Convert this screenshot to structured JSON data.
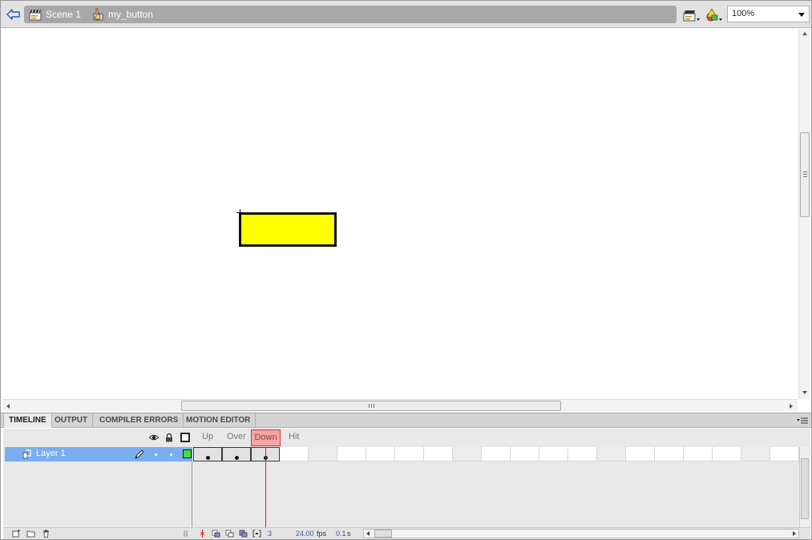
{
  "editbar": {
    "scene_label": "Scene 1",
    "symbol_label": "my_button",
    "zoom_value": "100%",
    "icons": {
      "back": "back-arrow-icon",
      "scene": "clapperboard-icon",
      "symbol": "button-symbol-icon",
      "edit_scene": "edit-scene-icon",
      "edit_symbol": "edit-symbol-icon"
    }
  },
  "stage": {
    "background_color": "#ffffff",
    "shape_fill": "#ffff00",
    "shape_stroke": "#111111"
  },
  "panel_tabs": [
    {
      "label": "TIMELINE",
      "active": true
    },
    {
      "label": "OUTPUT",
      "active": false
    },
    {
      "label": "COMPILER ERRORS",
      "active": false
    },
    {
      "label": "MOTION EDITOR",
      "active": false
    }
  ],
  "timeline": {
    "frame_labels": {
      "up": "Up",
      "over": "Over",
      "down": "Down",
      "hit": "Hit"
    },
    "layers": [
      {
        "name": "Layer 1",
        "selected": true,
        "outline_color": "#44dd44"
      }
    ],
    "keyframes": [
      1,
      2,
      3
    ],
    "current_frame": 3,
    "footer": {
      "current_frame": "3",
      "fps": "24.00",
      "fps_unit": "fps",
      "elapsed": "0.1",
      "elapsed_unit": "s"
    },
    "colors": {
      "layer_selected": "#7aaef0",
      "playhead": "#cc2222",
      "active_label_fill": "#f6a4a4"
    }
  }
}
